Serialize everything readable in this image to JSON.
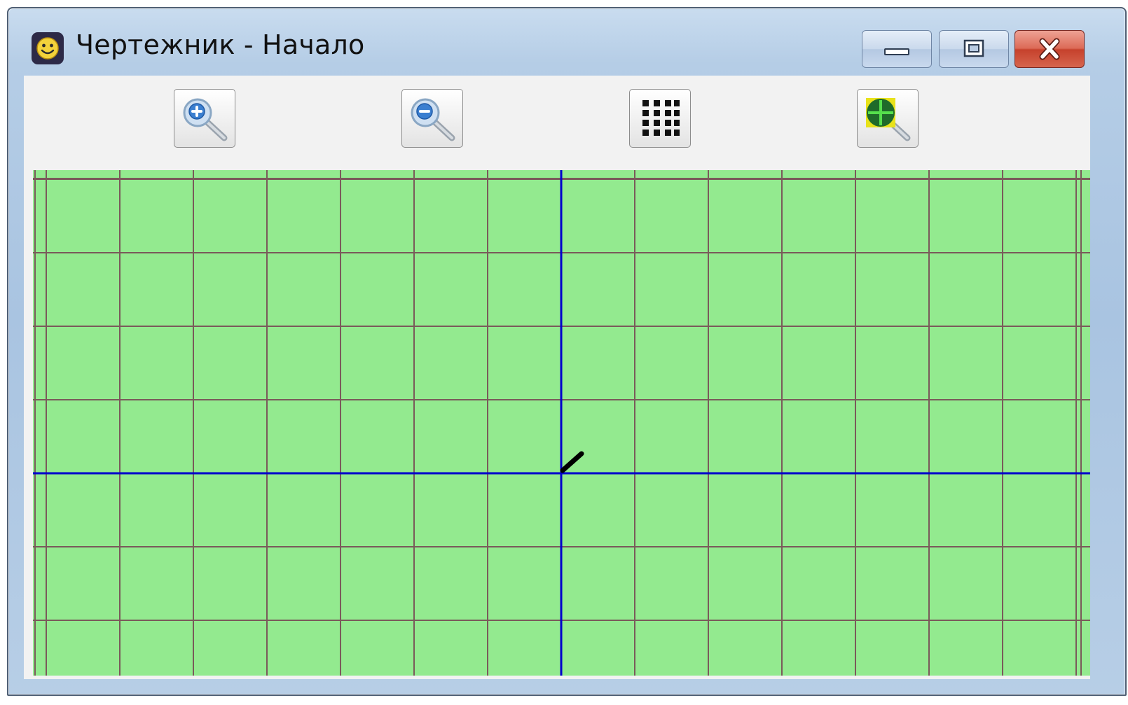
{
  "window": {
    "title": "Чертежник - Начало",
    "app_icon": "smiley-face-icon"
  },
  "caption_buttons": {
    "minimize": "minimize-icon",
    "maximize": "maximize-icon",
    "close": "close-icon"
  },
  "toolbar": {
    "buttons": [
      {
        "id": "zoom-in",
        "icon": "zoom-in-icon"
      },
      {
        "id": "zoom-out",
        "icon": "zoom-out-icon"
      },
      {
        "id": "toggle-grid",
        "icon": "grid-dots-icon"
      },
      {
        "id": "center-view",
        "icon": "zoom-center-icon"
      }
    ]
  },
  "canvas": {
    "background_color": "#93ea8f",
    "grid_line_color": "#7a5a5a",
    "axis_color": "#0000cc",
    "pen_color": "#000000",
    "grid_columns_left_of_origin": 7,
    "grid_columns_right_of_origin": 7,
    "grid_rows_above_origin": 4,
    "grid_rows_below_origin": 3
  }
}
